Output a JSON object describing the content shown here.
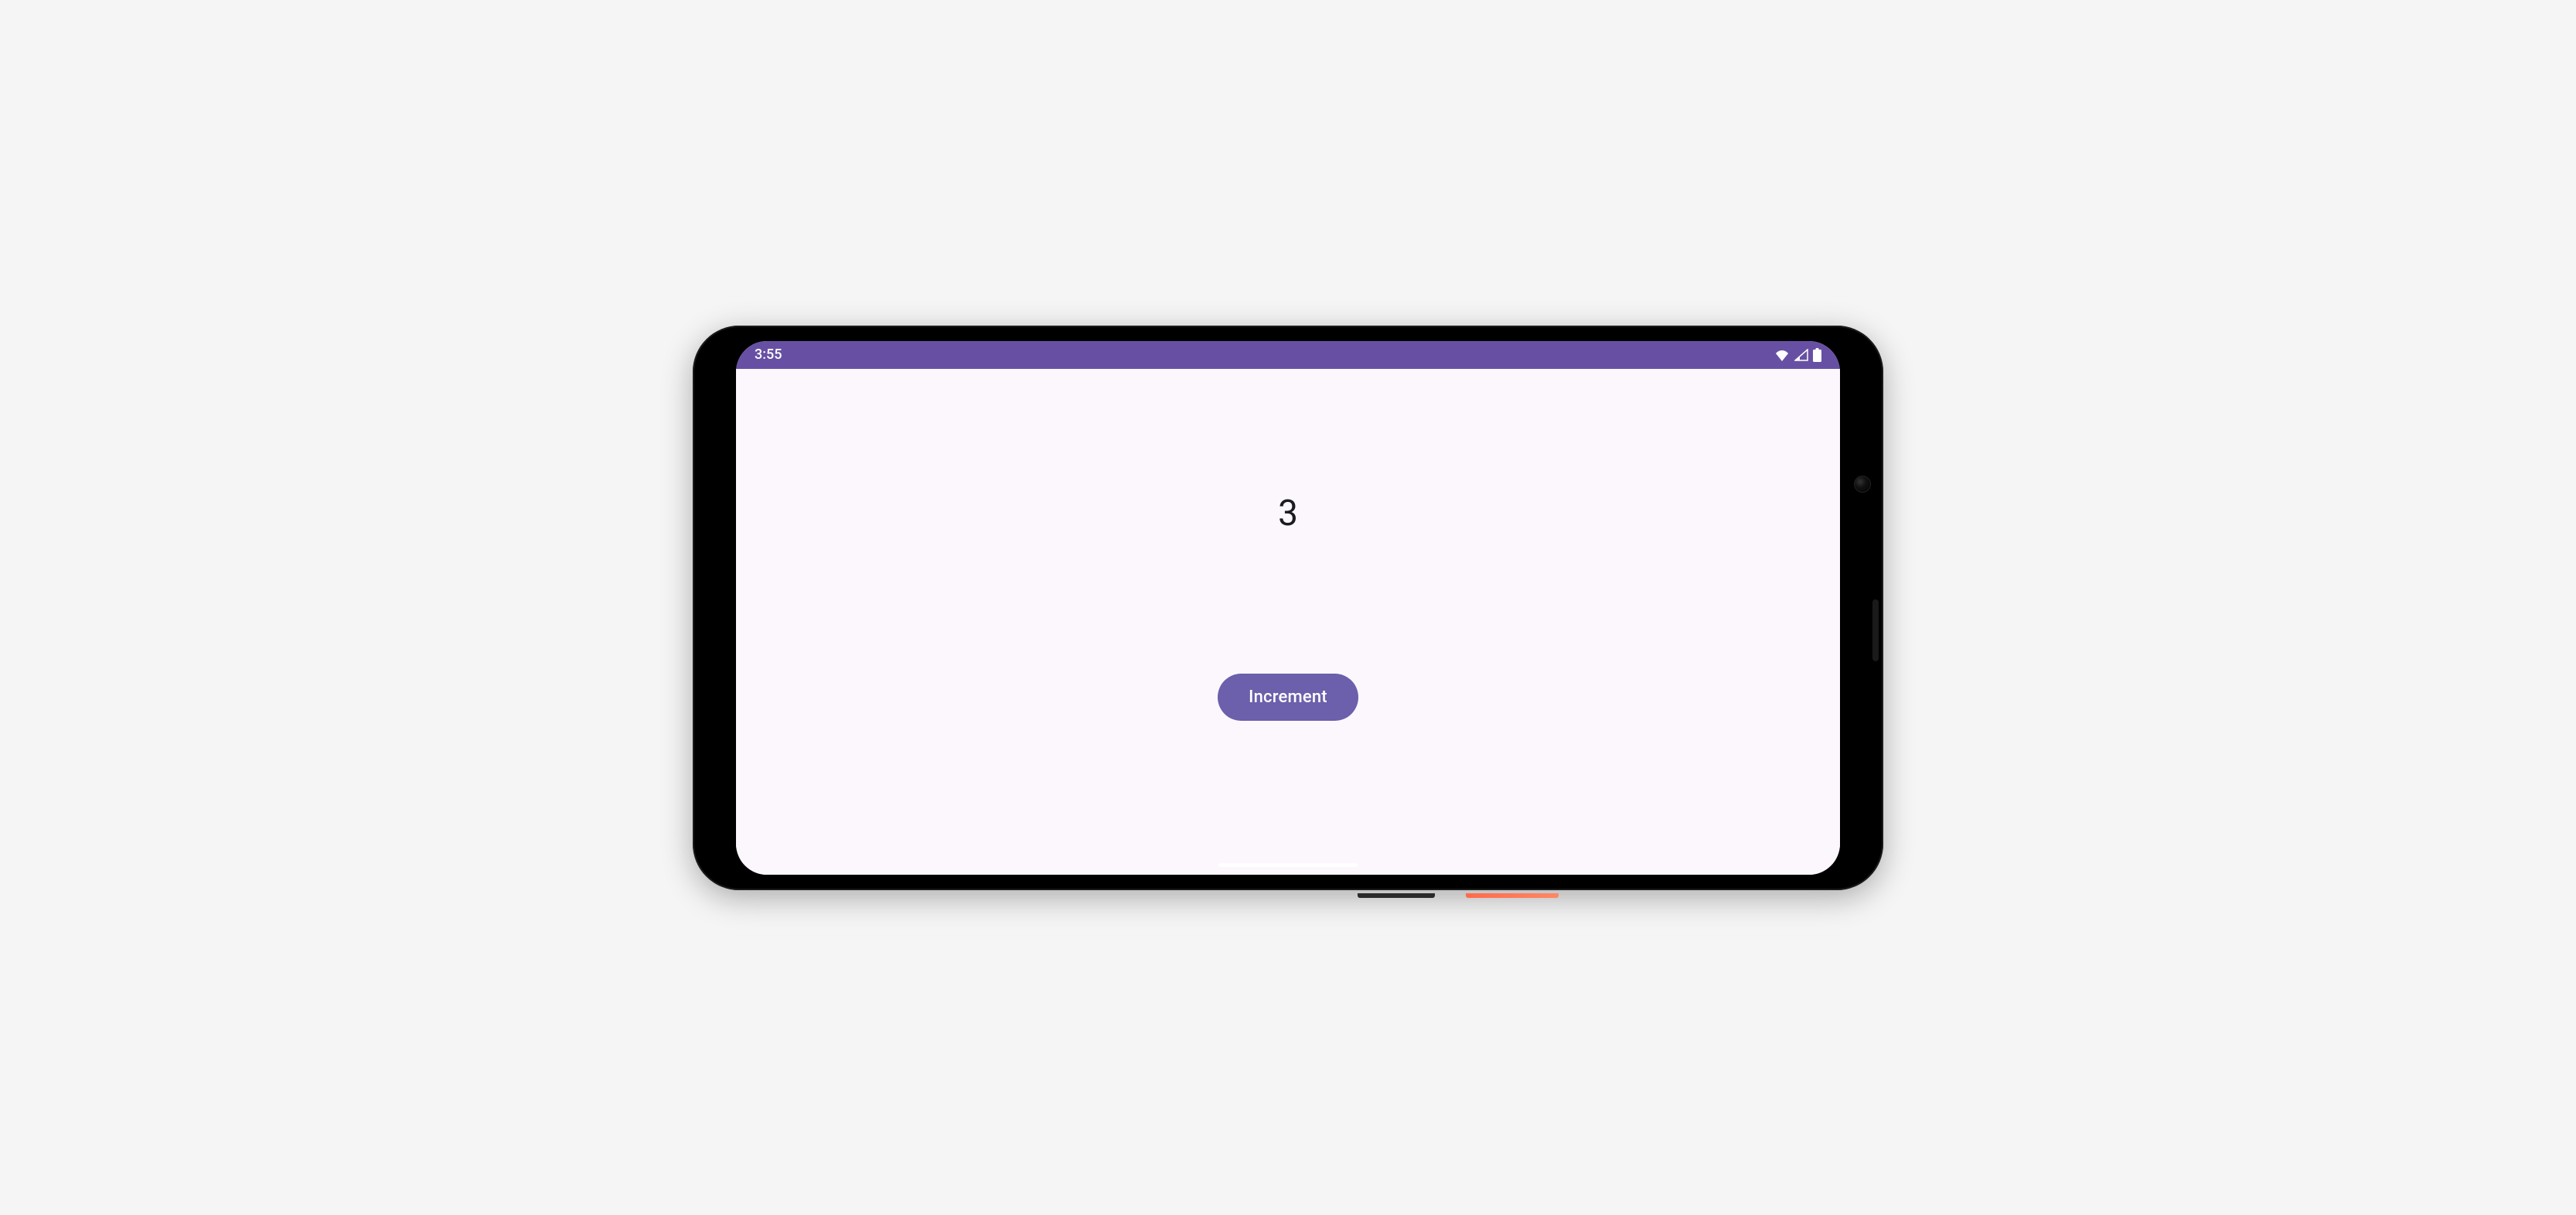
{
  "status_bar": {
    "time": "3:55"
  },
  "app": {
    "counter_value": "3",
    "button_label": "Increment"
  },
  "colors": {
    "primary": "#6750a4",
    "button_bg": "#6c5fab",
    "surface": "#fcf7fd"
  }
}
